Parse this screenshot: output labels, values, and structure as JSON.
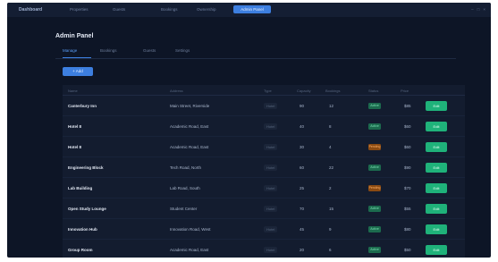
{
  "topbar": {
    "brand": "Dashboard",
    "nav": [
      "Properties",
      "Guests",
      "Bookings",
      "Ownership"
    ],
    "active": "Admin Panel",
    "window_controls": [
      "–",
      "□",
      "×"
    ]
  },
  "panel": {
    "title": "Admin Panel",
    "tabs": [
      "Manage",
      "Bookings",
      "Guests",
      "Settings"
    ],
    "add_button": "+ Add",
    "columns": [
      "Name",
      "Address",
      "Type",
      "Capacity",
      "Bookings",
      "Status",
      "Price",
      ""
    ]
  },
  "rows": [
    {
      "name": "Canterbury Inn",
      "address": "Main Street, Riverside",
      "type": "Hotel",
      "capacity": "90",
      "bookings": "12",
      "status": "Active",
      "price": "$85",
      "action": "Edit"
    },
    {
      "name": "Hotel 8",
      "address": "Academic Road, East",
      "type": "Hotel",
      "capacity": "40",
      "bookings": "8",
      "status": "Active",
      "price": "$60",
      "action": "Edit"
    },
    {
      "name": "Hotel 8",
      "address": "Academic Road, East",
      "type": "Hotel",
      "capacity": "30",
      "bookings": "4",
      "status": "Pending",
      "price": "$60",
      "action": "Edit"
    },
    {
      "name": "Engineering Block",
      "address": "Tech Road, North",
      "type": "Hotel",
      "capacity": "60",
      "bookings": "22",
      "status": "Active",
      "price": "$90",
      "action": "Edit"
    },
    {
      "name": "Lab Building",
      "address": "Lab Road, South",
      "type": "Hotel",
      "capacity": "25",
      "bookings": "2",
      "status": "Pending",
      "price": "$70",
      "action": "Edit"
    },
    {
      "name": "Open Study Lounge",
      "address": "Student Center",
      "type": "Hotel",
      "capacity": "70",
      "bookings": "15",
      "status": "Active",
      "price": "$55",
      "action": "Edit"
    },
    {
      "name": "Innovation Hub",
      "address": "Innovation Road, West",
      "type": "Hotel",
      "capacity": "45",
      "bookings": "9",
      "status": "Active",
      "price": "$80",
      "action": "Edit"
    },
    {
      "name": "Group Room",
      "address": "Academic Road, East",
      "type": "Hotel",
      "capacity": "20",
      "bookings": "6",
      "status": "Active",
      "price": "$50",
      "action": "Edit"
    }
  ],
  "colors": {
    "background": "#0d1526",
    "accent": "#3d7fe0",
    "active_status": "#1c6b4e",
    "pending_status": "#8a4a12",
    "edit_button": "#1fb27a"
  }
}
